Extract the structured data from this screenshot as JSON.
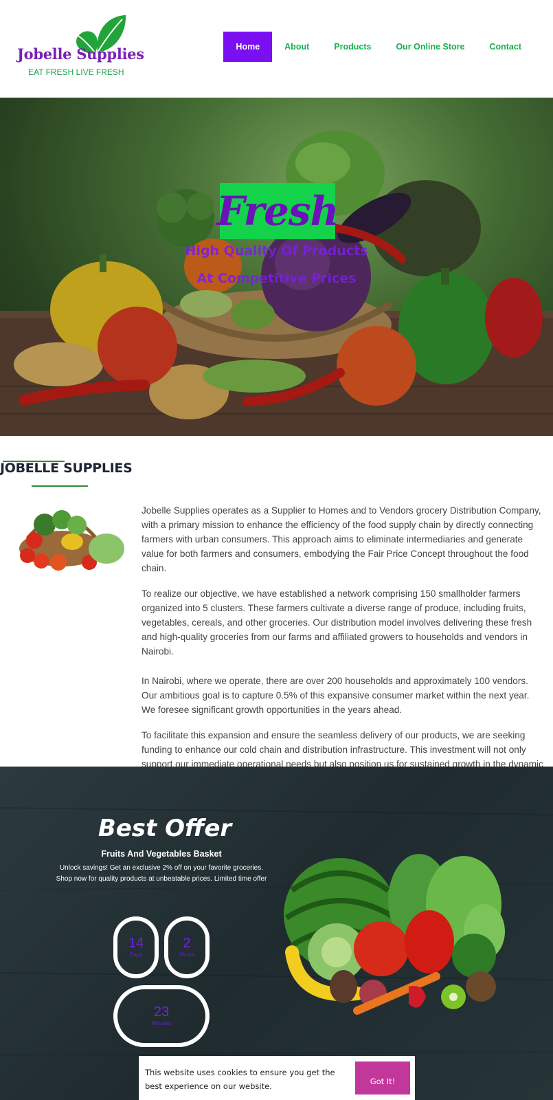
{
  "brand": {
    "name": "Jobelle Supplies",
    "tagline": "EAT FRESH LIVE FRESH",
    "leaf_color": "#22a43a",
    "name_color": "#7b1fb8"
  },
  "nav": {
    "items": [
      {
        "label": "Home",
        "active": true
      },
      {
        "label": "About",
        "active": false
      },
      {
        "label": "Products",
        "active": false
      },
      {
        "label": "Our Online Store",
        "active": false
      },
      {
        "label": "Contact",
        "active": false
      }
    ],
    "active_color": "#7a10f2",
    "link_color": "#17b24e"
  },
  "hero": {
    "badge": "Fresh",
    "line1": "High Quality Of Products",
    "line2": "At Competitive Prices",
    "badge_color": "#14d24a"
  },
  "about": {
    "title": "JOBELLE SUPPLIES",
    "paragraphs": [
      "Jobelle Supplies operates as a Supplier to Homes and to Vendors grocery Distribution Company, with a primary mission to enhance the efficiency of the food supply chain by directly connecting farmers with urban consumers. This approach aims to eliminate intermediaries and generate value for both farmers and consumers, embodying the Fair Price Concept throughout the food chain.",
      "To realize our objective, we have established a network comprising 150 smallholder farmers organized into 5 clusters. These farmers cultivate a diverse range of produce, including fruits, vegetables, cereals, and other groceries. Our distribution model involves delivering these fresh and high-quality groceries from our farms and affiliated growers to households and vendors in Nairobi.",
      "In Nairobi, where we operate, there are over 200  households and approximately 100 vendors. Our ambitious goal is to capture 0.5% of this expansive consumer market within the next year. We foresee significant growth opportunities in the years ahead.",
      "To facilitate this expansion and ensure the seamless delivery of our products, we are seeking funding to enhance our cold chain and distribution infrastructure. This investment will not only support our immediate operational needs but also position us for sustained growth in the dynamic and evolving food distribution sector."
    ]
  },
  "offer": {
    "title": "Best Offer",
    "subtitle": "Fruits And Vegetables Basket",
    "description": "Unlock savings! Get an exclusive 2% off on your favorite groceries. Shop now for quality products at unbeatable prices. Limited time offer",
    "countdown": {
      "days": {
        "value": "14",
        "label": "Days"
      },
      "hours": {
        "value": "2",
        "label": "Hours"
      },
      "minutes": {
        "value": "23",
        "label": "Minutes"
      }
    },
    "countdown_color": "#7a1ee8"
  },
  "cookie": {
    "text": "This website uses cookies to ensure you get the best experience on our website.",
    "button": "Got It!",
    "button_color": "#c2379a"
  }
}
